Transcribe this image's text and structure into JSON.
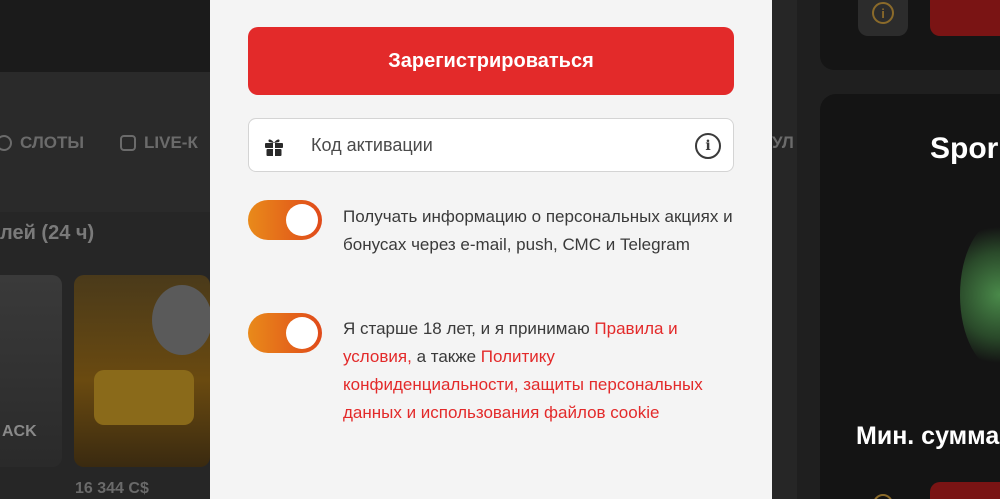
{
  "background": {
    "nav": {
      "slots_label": "СЛОТЫ",
      "live_label": "LIVE-К",
      "partial_right": "УЛ"
    },
    "section_title": "лей (24 ч)",
    "game_card_a_text": "ACK",
    "game_price": "16 344 C$",
    "right": {
      "title": "Spor",
      "min_label": "Мин. сумма"
    }
  },
  "modal": {
    "register_button": "Зарегистрироваться",
    "activation_code": {
      "placeholder": "Код активации",
      "value": ""
    },
    "consent_marketing": {
      "enabled": true,
      "text": "Получать информацию о персональных акциях и бонусах через e-mail, push, СМС и Telegram"
    },
    "consent_terms": {
      "enabled": true,
      "prefix": "Я старше 18 лет, и я принимаю ",
      "terms_link": "Правила и условия,",
      "middle": " а также ",
      "privacy_link": "Политику конфиденциальности, защиты персональных данных и использования файлов cookie"
    }
  },
  "colors": {
    "accent_red": "#e32a2a",
    "toggle_start": "#e98a1a",
    "toggle_end": "#e04a1a",
    "modal_bg": "#f4f4f4"
  },
  "icons": [
    "gift-icon",
    "info-icon",
    "slots-icon",
    "live-icon"
  ]
}
